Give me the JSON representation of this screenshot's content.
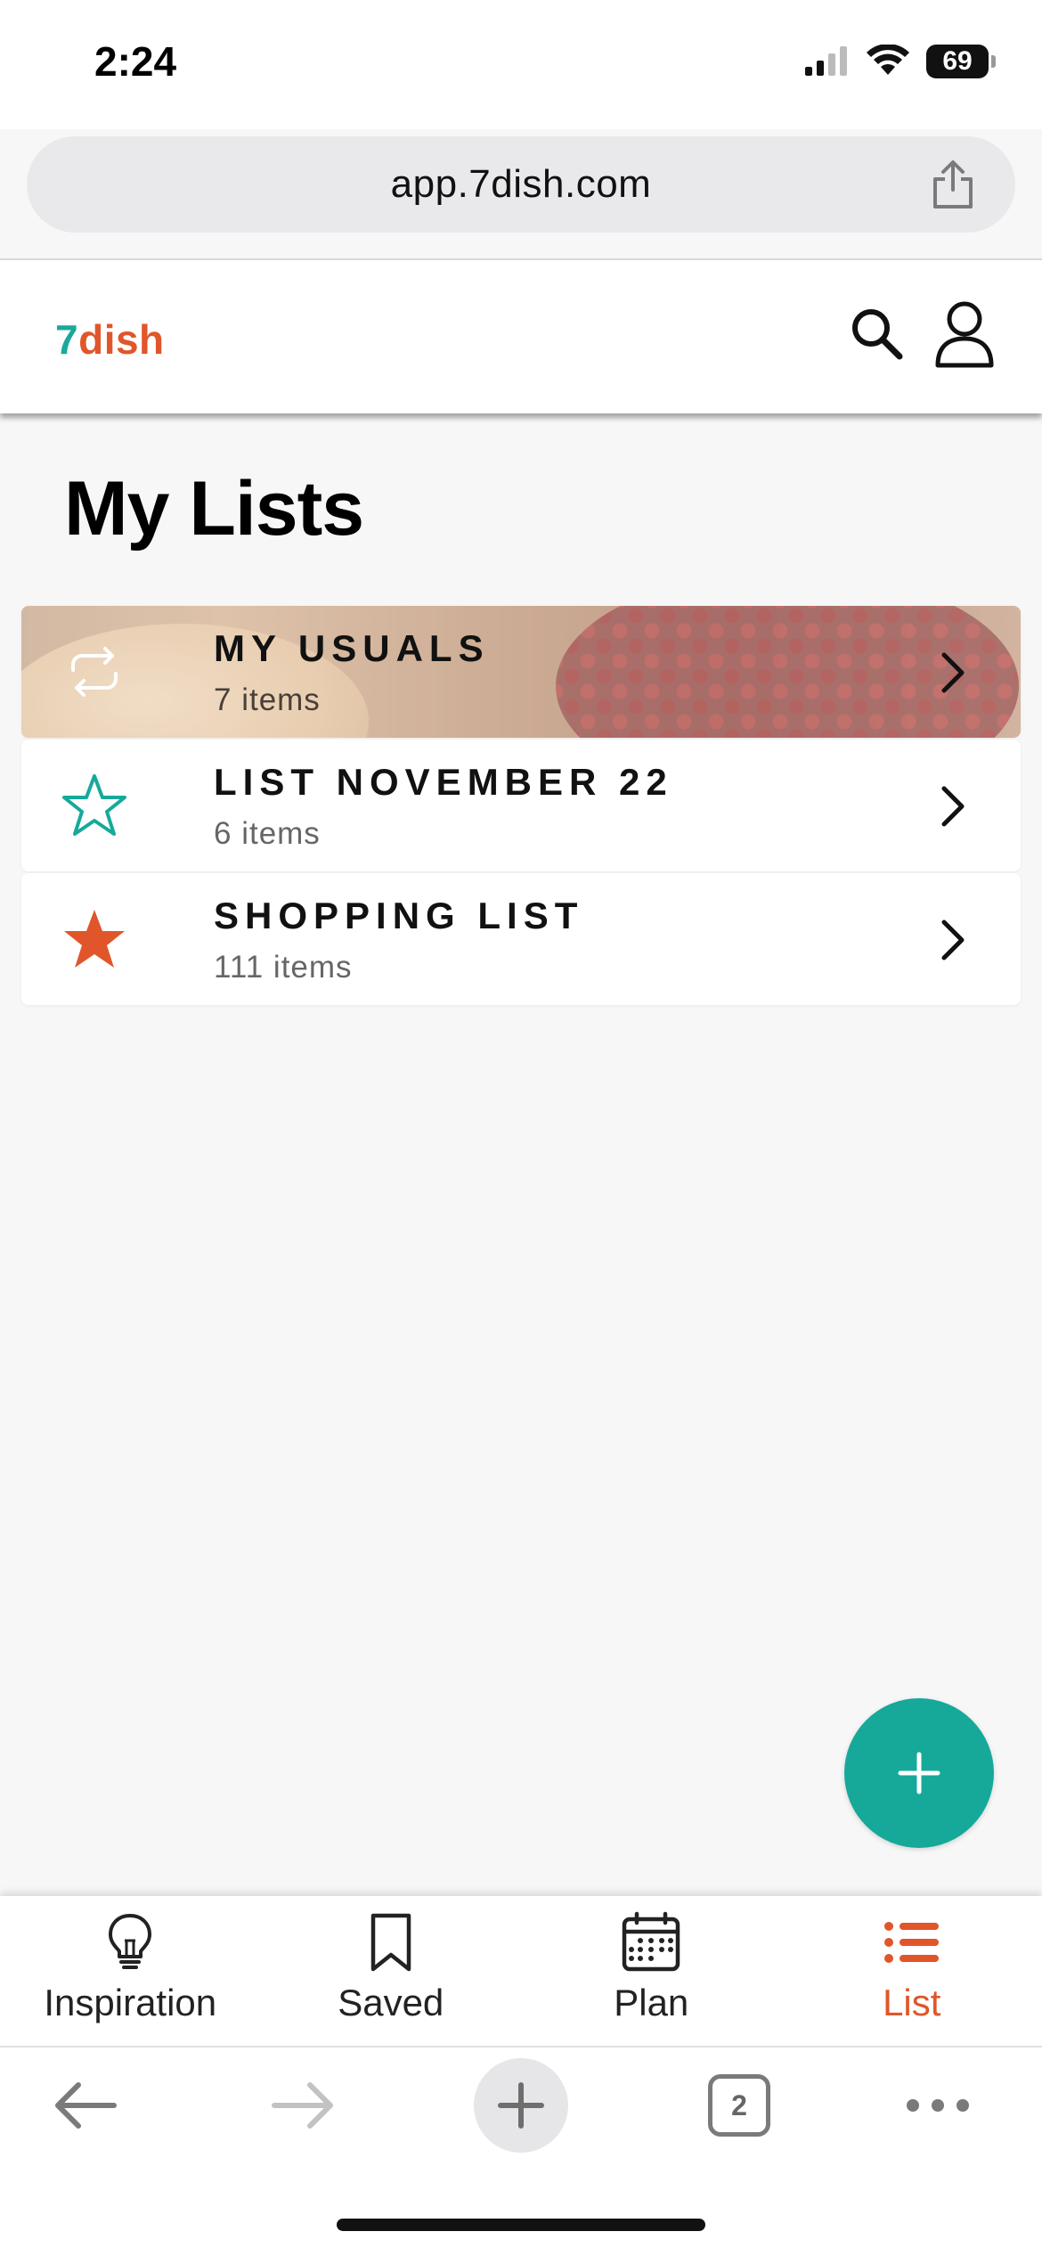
{
  "status_bar": {
    "time": "2:24",
    "battery": "69"
  },
  "browser": {
    "url": "app.7dish.com",
    "tab_count": "2"
  },
  "header": {
    "logo_prefix": "7",
    "logo_rest": "dish"
  },
  "page": {
    "title": "My Lists"
  },
  "lists": [
    {
      "title": "MY USUALS",
      "count": "7 items",
      "icon": "repeat-icon"
    },
    {
      "title": "LIST NOVEMBER 22",
      "count": "6 items",
      "icon": "star-outline-icon"
    },
    {
      "title": "SHOPPING LIST",
      "count": "111 items",
      "icon": "star-filled-icon"
    }
  ],
  "nav": [
    {
      "label": "Inspiration",
      "icon": "lightbulb-icon"
    },
    {
      "label": "Saved",
      "icon": "bookmark-icon"
    },
    {
      "label": "Plan",
      "icon": "calendar-icon"
    },
    {
      "label": "List",
      "icon": "list-icon",
      "active": true
    }
  ],
  "colors": {
    "accent_orange": "#e0562a",
    "accent_teal": "#16a99a"
  }
}
